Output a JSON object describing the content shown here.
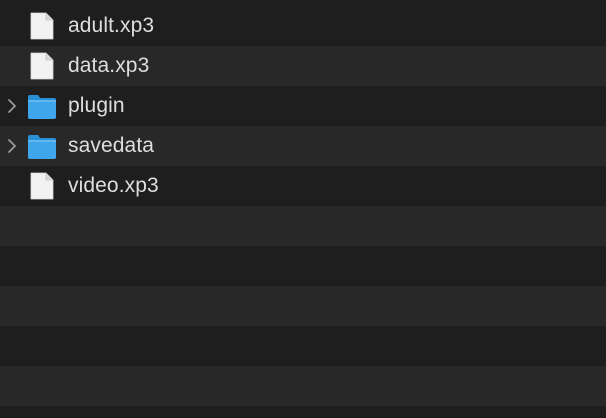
{
  "files": [
    {
      "name": "adult.xp3",
      "kind": "file",
      "icon": "document-icon",
      "expandable": false
    },
    {
      "name": "data.xp3",
      "kind": "file",
      "icon": "document-icon",
      "expandable": false
    },
    {
      "name": "plugin",
      "kind": "folder",
      "icon": "folder-icon",
      "expandable": true
    },
    {
      "name": "savedata",
      "kind": "folder",
      "icon": "folder-icon",
      "expandable": true
    },
    {
      "name": "video.xp3",
      "kind": "file",
      "icon": "document-icon",
      "expandable": false
    }
  ],
  "colors": {
    "background": "#1e1e1e",
    "stripe": "#282828",
    "text": "#dedede",
    "folder": "#3fa6ec",
    "document": "#f2f2f2"
  }
}
